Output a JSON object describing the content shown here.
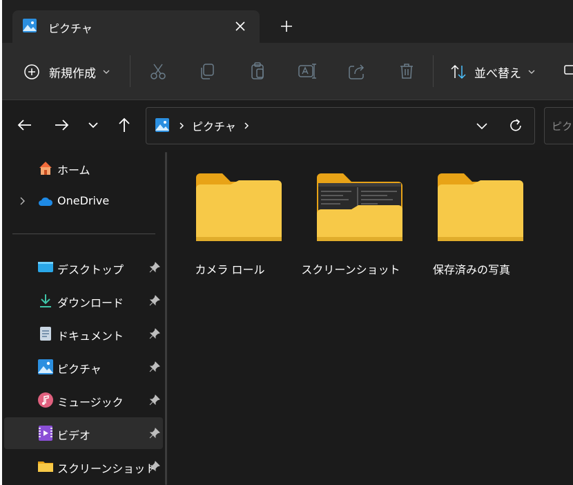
{
  "tab": {
    "title": "ピクチャ"
  },
  "toolbar": {
    "new_label": "新規作成",
    "sort_label": "並べ替え"
  },
  "address": {
    "crumbs": [
      "ピクチャ"
    ]
  },
  "search": {
    "placeholder": "ピクチャ"
  },
  "sidebar": {
    "items": [
      {
        "label": "ホーム",
        "icon": "home-icon"
      },
      {
        "label": "OneDrive",
        "icon": "onedrive-icon"
      },
      {
        "label": "デスクトップ",
        "icon": "desktop-icon",
        "pinned": true
      },
      {
        "label": "ダウンロード",
        "icon": "download-icon",
        "pinned": true
      },
      {
        "label": "ドキュメント",
        "icon": "document-icon",
        "pinned": true
      },
      {
        "label": "ピクチャ",
        "icon": "pictures-icon",
        "pinned": true
      },
      {
        "label": "ミュージック",
        "icon": "music-icon",
        "pinned": true
      },
      {
        "label": "ビデオ",
        "icon": "video-icon",
        "pinned": true,
        "selected": true
      },
      {
        "label": "スクリーンショット",
        "icon": "folder-icon",
        "pinned": true
      }
    ]
  },
  "folders": [
    {
      "name": "カメラ ロール"
    },
    {
      "name": "スクリーンショット"
    },
    {
      "name": "保存済みの写真"
    }
  ],
  "colors": {
    "folder": "#f7c948",
    "accent": "#4cc2ff",
    "background": "#1b1b1b"
  }
}
